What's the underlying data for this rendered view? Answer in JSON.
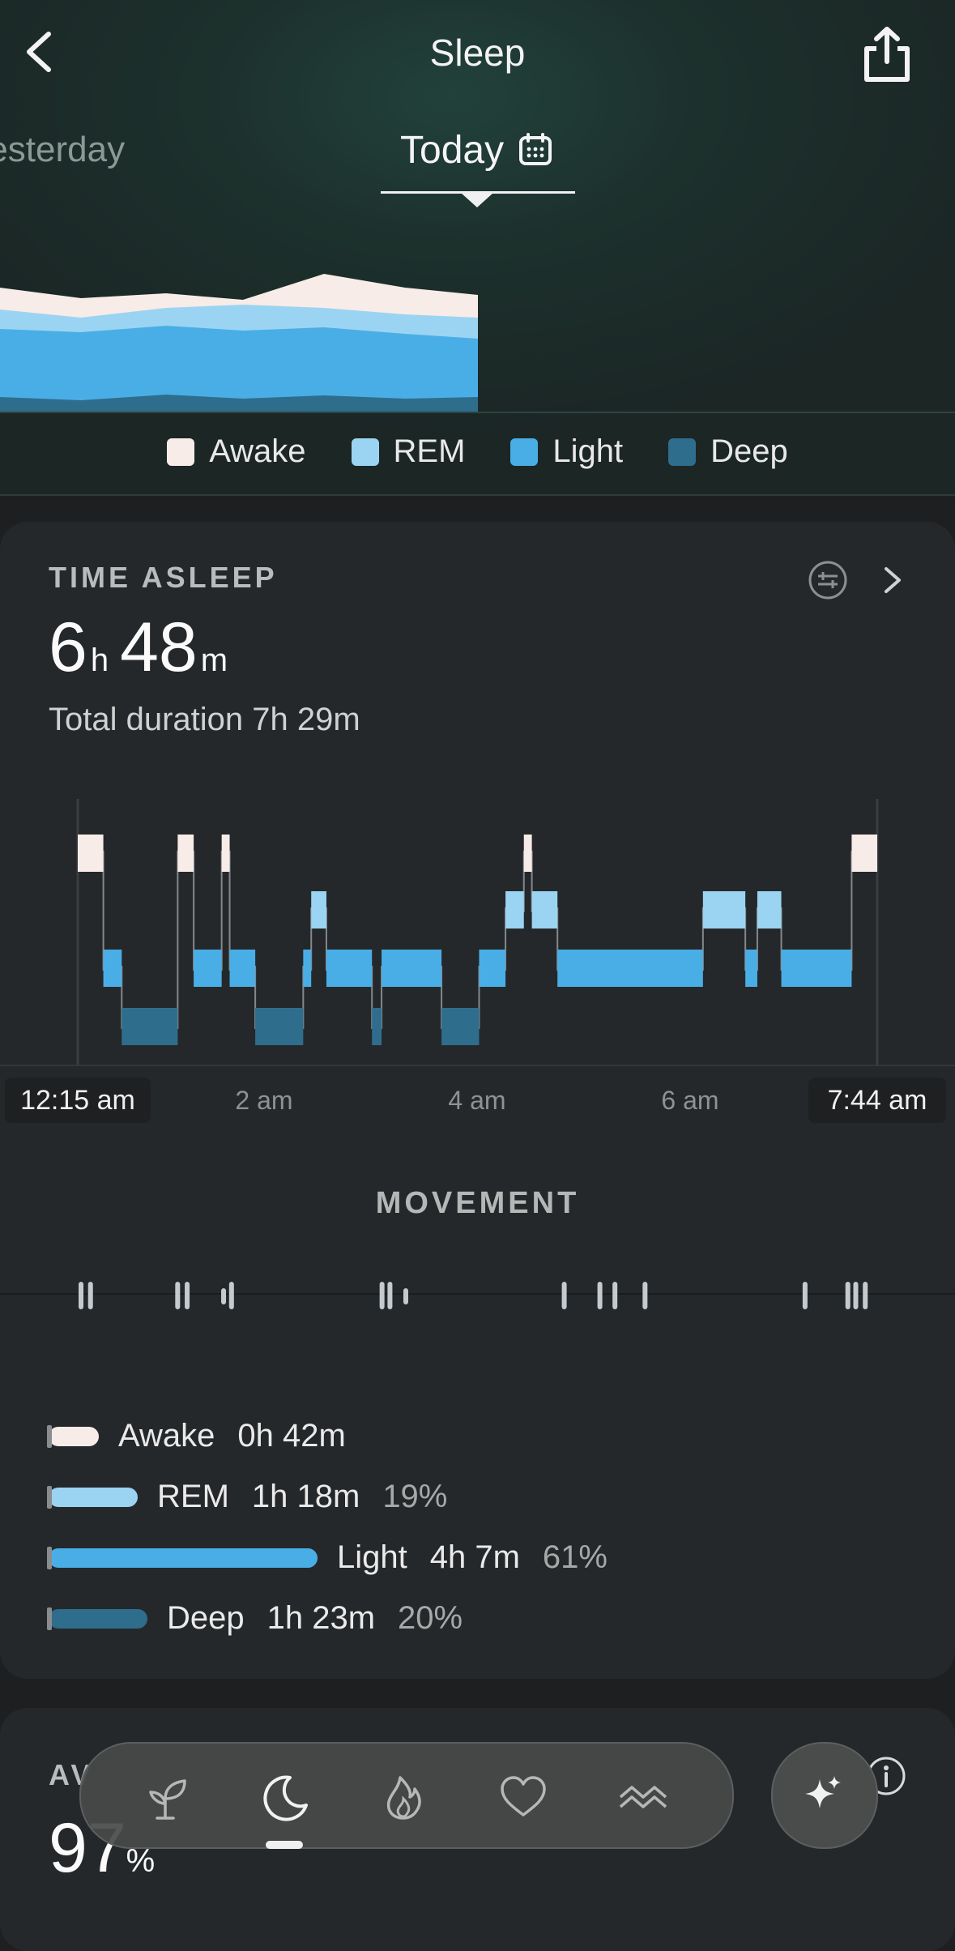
{
  "header": {
    "title": "Sleep",
    "prev_day": "Yesterday",
    "current_day": "Today"
  },
  "legend": [
    {
      "label": "Awake",
      "color": "#f7ece8"
    },
    {
      "label": "REM",
      "color": "#9bd4f2"
    },
    {
      "label": "Light",
      "color": "#4aaee6"
    },
    {
      "label": "Deep",
      "color": "#2f6d8d"
    }
  ],
  "time_asleep": {
    "label": "TIME ASLEEP",
    "hours": "6",
    "hours_unit": "h",
    "minutes": "48",
    "minutes_unit": "m",
    "total": "Total duration 7h 29m"
  },
  "chart_data": {
    "type": "area",
    "x_ticks": [
      "12:15 am",
      "2 am",
      "4 am",
      "6 am",
      "7:44 am"
    ],
    "start_label": "12:15 am",
    "end_label": "7:44 am",
    "stages": [
      "Awake",
      "REM",
      "Light",
      "Deep"
    ],
    "hypnogram": [
      {
        "stage": "Awake",
        "from": 0.0,
        "to": 0.032
      },
      {
        "stage": "Light",
        "from": 0.032,
        "to": 0.055
      },
      {
        "stage": "Deep",
        "from": 0.055,
        "to": 0.125
      },
      {
        "stage": "Awake",
        "from": 0.125,
        "to": 0.145
      },
      {
        "stage": "Light",
        "from": 0.145,
        "to": 0.18
      },
      {
        "stage": "Awake",
        "from": 0.18,
        "to": 0.19
      },
      {
        "stage": "Light",
        "from": 0.19,
        "to": 0.222
      },
      {
        "stage": "Deep",
        "from": 0.222,
        "to": 0.282
      },
      {
        "stage": "Light",
        "from": 0.282,
        "to": 0.292
      },
      {
        "stage": "REM",
        "from": 0.292,
        "to": 0.311
      },
      {
        "stage": "Light",
        "from": 0.311,
        "to": 0.368
      },
      {
        "stage": "Deep",
        "from": 0.368,
        "to": 0.38
      },
      {
        "stage": "Light",
        "from": 0.38,
        "to": 0.455
      },
      {
        "stage": "Deep",
        "from": 0.455,
        "to": 0.502
      },
      {
        "stage": "Light",
        "from": 0.502,
        "to": 0.535
      },
      {
        "stage": "REM",
        "from": 0.535,
        "to": 0.558
      },
      {
        "stage": "Awake",
        "from": 0.558,
        "to": 0.568
      },
      {
        "stage": "REM",
        "from": 0.568,
        "to": 0.6
      },
      {
        "stage": "Light",
        "from": 0.6,
        "to": 0.782
      },
      {
        "stage": "REM",
        "from": 0.782,
        "to": 0.835
      },
      {
        "stage": "Light",
        "from": 0.835,
        "to": 0.85
      },
      {
        "stage": "REM",
        "from": 0.85,
        "to": 0.88
      },
      {
        "stage": "Light",
        "from": 0.88,
        "to": 0.968
      },
      {
        "stage": "Awake",
        "from": 0.968,
        "to": 1.0
      }
    ]
  },
  "movement": {
    "label": "MOVEMENT",
    "events": [
      0.0,
      0.012,
      0.122,
      0.134,
      0.18,
      0.19,
      0.38,
      0.39,
      0.41,
      0.61,
      0.655,
      0.674,
      0.712,
      0.914,
      0.968,
      0.978,
      0.99
    ]
  },
  "breakdown": [
    {
      "name": "Awake",
      "duration": "0h 42m",
      "pct": "",
      "fraction": 0.09,
      "color": "#f7ece8"
    },
    {
      "name": "REM",
      "duration": "1h 18m",
      "pct": "19%",
      "fraction": 0.19,
      "color": "#9bd4f2"
    },
    {
      "name": "Light",
      "duration": "4h 7m",
      "pct": "61%",
      "fraction": 0.61,
      "color": "#4aaee6"
    },
    {
      "name": "Deep",
      "duration": "1h 23m",
      "pct": "20%",
      "fraction": 0.2,
      "color": "#2f6d8d"
    }
  ],
  "average": {
    "label": "AV",
    "value": "97",
    "unit": "%"
  },
  "nav": {
    "items": [
      "sprout-icon",
      "moon-icon",
      "flame-icon",
      "heart-icon",
      "waves-icon"
    ],
    "active": 1,
    "fab": "sparkle-icon"
  }
}
